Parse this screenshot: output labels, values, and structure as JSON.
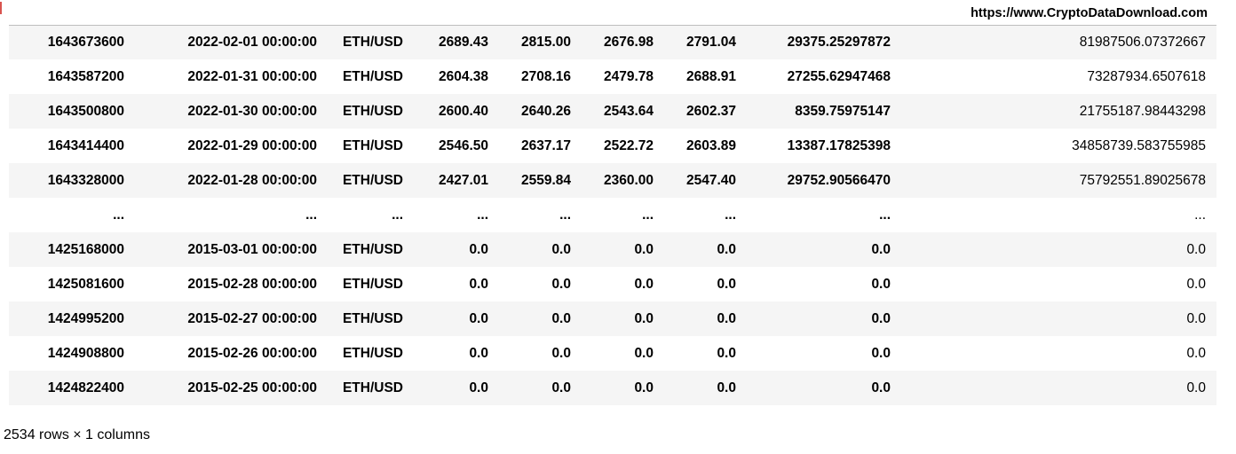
{
  "header": {
    "column_label": "https://www.CryptoDataDownload.com"
  },
  "rows": [
    {
      "unix": "1643673600",
      "date": "2022-02-01 00:00:00",
      "symbol": "ETH/USD",
      "open": "2689.43",
      "high": "2815.00",
      "low": "2676.98",
      "close": "2791.04",
      "volume_eth": "29375.25297872",
      "volume_usd": "81987506.07372667"
    },
    {
      "unix": "1643587200",
      "date": "2022-01-31 00:00:00",
      "symbol": "ETH/USD",
      "open": "2604.38",
      "high": "2708.16",
      "low": "2479.78",
      "close": "2688.91",
      "volume_eth": "27255.62947468",
      "volume_usd": "73287934.6507618"
    },
    {
      "unix": "1643500800",
      "date": "2022-01-30 00:00:00",
      "symbol": "ETH/USD",
      "open": "2600.40",
      "high": "2640.26",
      "low": "2543.64",
      "close": "2602.37",
      "volume_eth": "8359.75975147",
      "volume_usd": "21755187.98443298"
    },
    {
      "unix": "1643414400",
      "date": "2022-01-29 00:00:00",
      "symbol": "ETH/USD",
      "open": "2546.50",
      "high": "2637.17",
      "low": "2522.72",
      "close": "2603.89",
      "volume_eth": "13387.17825398",
      "volume_usd": "34858739.583755985"
    },
    {
      "unix": "1643328000",
      "date": "2022-01-28 00:00:00",
      "symbol": "ETH/USD",
      "open": "2427.01",
      "high": "2559.84",
      "low": "2360.00",
      "close": "2547.40",
      "volume_eth": "29752.90566470",
      "volume_usd": "75792551.89025678"
    },
    {
      "unix": "...",
      "date": "...",
      "symbol": "...",
      "open": "...",
      "high": "...",
      "low": "...",
      "close": "...",
      "volume_eth": "...",
      "volume_usd": "..."
    },
    {
      "unix": "1425168000",
      "date": "2015-03-01 00:00:00",
      "symbol": "ETH/USD",
      "open": "0.0",
      "high": "0.0",
      "low": "0.0",
      "close": "0.0",
      "volume_eth": "0.0",
      "volume_usd": "0.0"
    },
    {
      "unix": "1425081600",
      "date": "2015-02-28 00:00:00",
      "symbol": "ETH/USD",
      "open": "0.0",
      "high": "0.0",
      "low": "0.0",
      "close": "0.0",
      "volume_eth": "0.0",
      "volume_usd": "0.0"
    },
    {
      "unix": "1424995200",
      "date": "2015-02-27 00:00:00",
      "symbol": "ETH/USD",
      "open": "0.0",
      "high": "0.0",
      "low": "0.0",
      "close": "0.0",
      "volume_eth": "0.0",
      "volume_usd": "0.0"
    },
    {
      "unix": "1424908800",
      "date": "2015-02-26 00:00:00",
      "symbol": "ETH/USD",
      "open": "0.0",
      "high": "0.0",
      "low": "0.0",
      "close": "0.0",
      "volume_eth": "0.0",
      "volume_usd": "0.0"
    },
    {
      "unix": "1424822400",
      "date": "2015-02-25 00:00:00",
      "symbol": "ETH/USD",
      "open": "0.0",
      "high": "0.0",
      "low": "0.0",
      "close": "0.0",
      "volume_eth": "0.0",
      "volume_usd": "0.0"
    }
  ],
  "footer": {
    "shape_text": "2534 rows × 1 columns"
  },
  "colors": {
    "row_stripe": "#f5f5f5",
    "header_rule": "#bdbdbd"
  }
}
